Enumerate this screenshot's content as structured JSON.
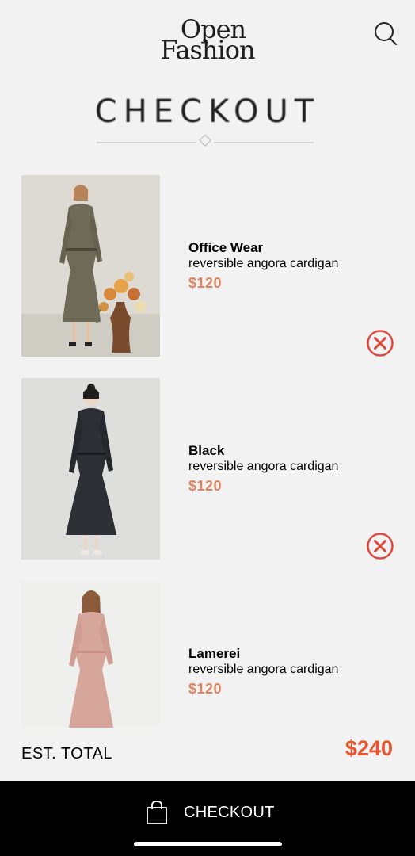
{
  "header": {
    "logo_line1": "Open",
    "logo_line2": "Fashion",
    "search_icon": "search-icon"
  },
  "page_title": "CHECKOUT",
  "items": [
    {
      "brand": "Office Wear",
      "description": "reversible angora cardigan",
      "price": "$120",
      "image": "model in grey tweed suit dress with flower vase",
      "remove_icon": "close-circle-icon"
    },
    {
      "brand": "Black",
      "description": "reversible angora cardigan",
      "price": "$120",
      "image": "model in black tailored dress",
      "remove_icon": "close-circle-icon"
    },
    {
      "brand": "Lamerei",
      "description": "reversible angora cardigan",
      "price": "$120",
      "image": "model in pink knit dress"
    }
  ],
  "summary": {
    "total_label": "EST. TOTAL",
    "total_value": "$240"
  },
  "footer": {
    "checkout_label": "CHECKOUT",
    "bag_icon": "shopping-bag-icon"
  },
  "colors": {
    "background": "#f2f2f2",
    "price": "#dd8560",
    "total": "#e9542f",
    "remove": "#e0463d",
    "footer": "#000000"
  }
}
